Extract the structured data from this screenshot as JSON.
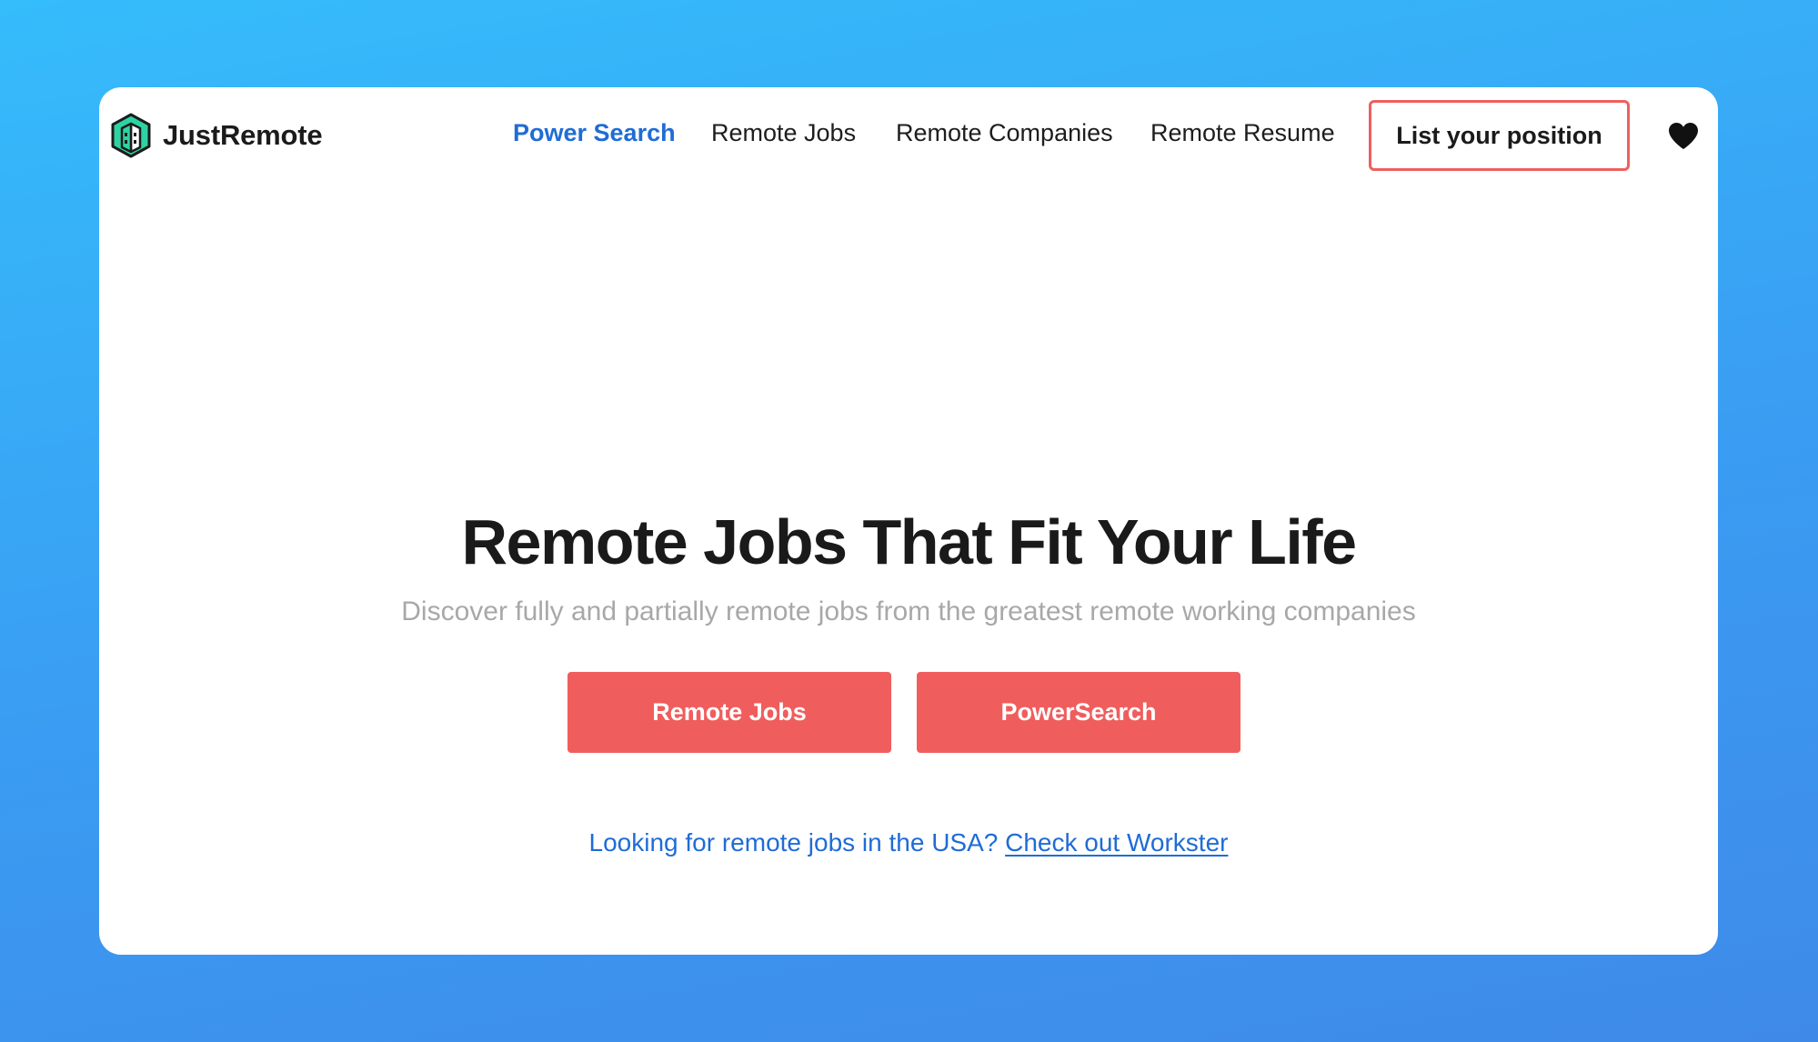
{
  "brand": {
    "name": "JustRemote",
    "logo_icon": "hexagon-buildings-logo",
    "logo_colors": [
      "#2ed3a4",
      "#1b1b1b"
    ]
  },
  "nav": {
    "items": [
      {
        "label": "Power Search",
        "active": true
      },
      {
        "label": "Remote Jobs",
        "active": false
      },
      {
        "label": "Remote Companies",
        "active": false
      },
      {
        "label": "Remote Resume",
        "active": false
      }
    ],
    "cta_label": "List your position",
    "favorites_icon": "heart-icon"
  },
  "hero": {
    "title": "Remote Jobs That Fit Your Life",
    "subtitle": "Discover fully and partially remote jobs from the greatest remote working companies",
    "buttons": [
      {
        "label": "Remote Jobs"
      },
      {
        "label": "PowerSearch"
      }
    ],
    "usa_prompt": "Looking for remote jobs in the USA?",
    "usa_link": "Check out Workster"
  },
  "colors": {
    "accent_blue": "#1f6cd6",
    "accent_red": "#f05d5d",
    "background_gradient": [
      "#35bcfb",
      "#3f8ae9"
    ]
  }
}
